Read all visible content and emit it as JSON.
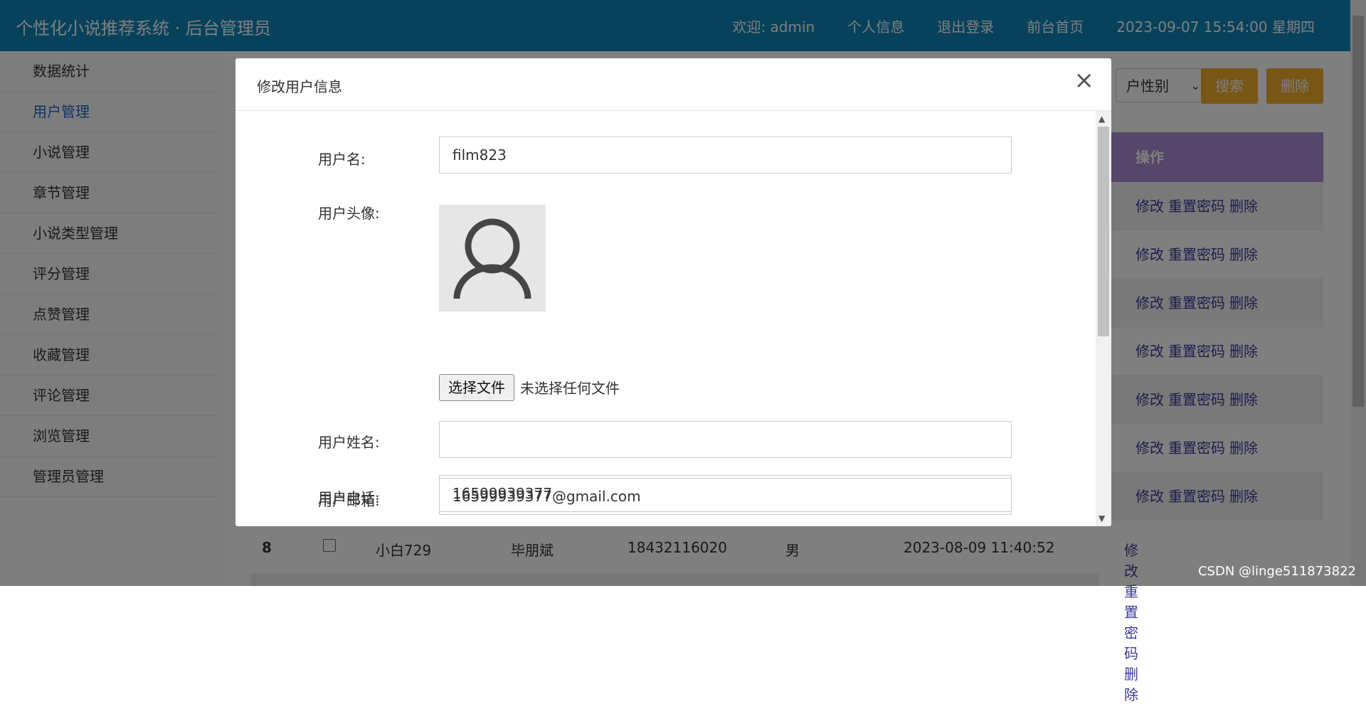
{
  "header": {
    "title": "个性化小说推荐系统 · 后台管理员",
    "welcome": "欢迎:  admin",
    "profile": "个人信息",
    "logout": "退出登录",
    "home": "前台首页",
    "datetime": "2023-09-07  15:54:00  星期四"
  },
  "sidebar": {
    "items": [
      {
        "label": "数据统计"
      },
      {
        "label": "用户管理"
      },
      {
        "label": "小说管理"
      },
      {
        "label": "章节管理"
      },
      {
        "label": "小说类型管理"
      },
      {
        "label": "评分管理"
      },
      {
        "label": "点赞管理"
      },
      {
        "label": "收藏管理"
      },
      {
        "label": "评论管理"
      },
      {
        "label": "浏览管理"
      },
      {
        "label": "管理员管理"
      }
    ]
  },
  "toolbar": {
    "gender_select": "户性别",
    "search": "搜索",
    "delete": "删除"
  },
  "table": {
    "ops_header": "操作",
    "op_edit": "修改",
    "op_reset": "重置密码",
    "op_delete": "删除",
    "bottom_row": {
      "id": "8",
      "username": "小白729",
      "realname": "毕朋斌",
      "phone": "18432116020",
      "gender": "男",
      "created": "2023-08-09 11:40:52"
    }
  },
  "modal": {
    "title": "修改用户信息",
    "close": "×",
    "fields": {
      "username_label": "用户名:",
      "username_value": "film823",
      "avatar_label": "用户头像:",
      "file_button": "选择文件",
      "file_status": "未选择任何文件",
      "realname_label": "用户姓名:",
      "realname_value": "",
      "phone_label": "用户电话:",
      "phone_value": "16599939377",
      "email_label": "用户邮箱:",
      "email_value": "16599939377@gmail.com"
    }
  },
  "watermark": "CSDN @linge511873822",
  "colors": {
    "topbar": "#0e84b8",
    "active_menu": "#1b66c9",
    "orange_button": "#f0ad2c",
    "table_header": "#a98fd3"
  }
}
